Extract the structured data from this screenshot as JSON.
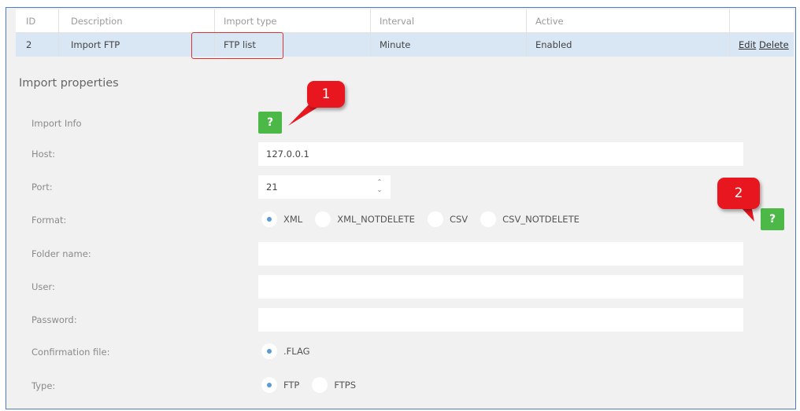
{
  "table": {
    "headers": [
      "ID",
      "Description",
      "Import type",
      "Interval",
      "Active"
    ],
    "row": {
      "id": "2",
      "description": "Import FTP",
      "import_type": "FTP list",
      "interval": "Minute",
      "active": "Enabled",
      "edit_label": "Edit",
      "delete_label": "Delete"
    }
  },
  "form": {
    "section_title": "Import properties",
    "import_info_label": "Import Info",
    "help_icon": "?",
    "host_label": "Host:",
    "host_value": "127.0.0.1",
    "port_label": "Port:",
    "port_value": "21",
    "format_label": "Format:",
    "format_options": [
      "XML",
      "XML_NOTDELETE",
      "CSV",
      "CSV_NOTDELETE"
    ],
    "format_selected": "XML",
    "folder_label": "Folder name:",
    "folder_value": "",
    "user_label": "User:",
    "user_value": "",
    "password_label": "Password:",
    "password_value": "",
    "confirmation_label": "Confirmation file:",
    "confirmation_options": [
      ".FLAG"
    ],
    "confirmation_selected": ".FLAG",
    "type_label": "Type:",
    "type_options": [
      "FTP",
      "FTPS"
    ],
    "type_selected": "FTP"
  },
  "callouts": {
    "one": "1",
    "two": "2"
  },
  "colors": {
    "accent_green": "#4cb848",
    "callout_red": "#e8161e",
    "selected_row": "#d9e6f4",
    "radio_dot": "#5b9bd5"
  }
}
